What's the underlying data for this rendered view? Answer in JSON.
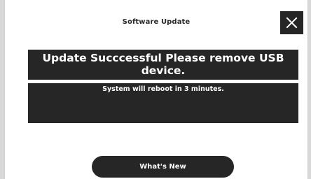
{
  "dialog": {
    "title": "Software Update",
    "close_icon": "close-icon",
    "message": "Update Succcessful Please remove USB device.",
    "submessage": "System will reboot in 3 minutes.",
    "primary_button_label": "What's New"
  },
  "colors": {
    "panel": "#262626",
    "background": "#ffffff",
    "text_on_dark": "#ffffff"
  }
}
